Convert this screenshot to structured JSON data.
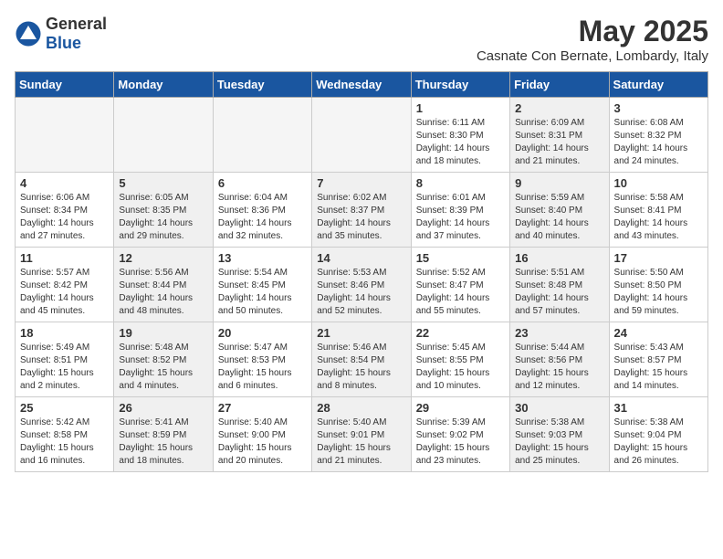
{
  "header": {
    "logo_general": "General",
    "logo_blue": "Blue",
    "month": "May 2025",
    "location": "Casnate Con Bernate, Lombardy, Italy"
  },
  "days_of_week": [
    "Sunday",
    "Monday",
    "Tuesday",
    "Wednesday",
    "Thursday",
    "Friday",
    "Saturday"
  ],
  "weeks": [
    [
      {
        "day": "",
        "info": "",
        "shaded": false,
        "empty": true
      },
      {
        "day": "",
        "info": "",
        "shaded": false,
        "empty": true
      },
      {
        "day": "",
        "info": "",
        "shaded": false,
        "empty": true
      },
      {
        "day": "",
        "info": "",
        "shaded": false,
        "empty": true
      },
      {
        "day": "1",
        "info": "Sunrise: 6:11 AM\nSunset: 8:30 PM\nDaylight: 14 hours\nand 18 minutes.",
        "shaded": false,
        "empty": false
      },
      {
        "day": "2",
        "info": "Sunrise: 6:09 AM\nSunset: 8:31 PM\nDaylight: 14 hours\nand 21 minutes.",
        "shaded": true,
        "empty": false
      },
      {
        "day": "3",
        "info": "Sunrise: 6:08 AM\nSunset: 8:32 PM\nDaylight: 14 hours\nand 24 minutes.",
        "shaded": false,
        "empty": false
      }
    ],
    [
      {
        "day": "4",
        "info": "Sunrise: 6:06 AM\nSunset: 8:34 PM\nDaylight: 14 hours\nand 27 minutes.",
        "shaded": false,
        "empty": false
      },
      {
        "day": "5",
        "info": "Sunrise: 6:05 AM\nSunset: 8:35 PM\nDaylight: 14 hours\nand 29 minutes.",
        "shaded": true,
        "empty": false
      },
      {
        "day": "6",
        "info": "Sunrise: 6:04 AM\nSunset: 8:36 PM\nDaylight: 14 hours\nand 32 minutes.",
        "shaded": false,
        "empty": false
      },
      {
        "day": "7",
        "info": "Sunrise: 6:02 AM\nSunset: 8:37 PM\nDaylight: 14 hours\nand 35 minutes.",
        "shaded": true,
        "empty": false
      },
      {
        "day": "8",
        "info": "Sunrise: 6:01 AM\nSunset: 8:39 PM\nDaylight: 14 hours\nand 37 minutes.",
        "shaded": false,
        "empty": false
      },
      {
        "day": "9",
        "info": "Sunrise: 5:59 AM\nSunset: 8:40 PM\nDaylight: 14 hours\nand 40 minutes.",
        "shaded": true,
        "empty": false
      },
      {
        "day": "10",
        "info": "Sunrise: 5:58 AM\nSunset: 8:41 PM\nDaylight: 14 hours\nand 43 minutes.",
        "shaded": false,
        "empty": false
      }
    ],
    [
      {
        "day": "11",
        "info": "Sunrise: 5:57 AM\nSunset: 8:42 PM\nDaylight: 14 hours\nand 45 minutes.",
        "shaded": false,
        "empty": false
      },
      {
        "day": "12",
        "info": "Sunrise: 5:56 AM\nSunset: 8:44 PM\nDaylight: 14 hours\nand 48 minutes.",
        "shaded": true,
        "empty": false
      },
      {
        "day": "13",
        "info": "Sunrise: 5:54 AM\nSunset: 8:45 PM\nDaylight: 14 hours\nand 50 minutes.",
        "shaded": false,
        "empty": false
      },
      {
        "day": "14",
        "info": "Sunrise: 5:53 AM\nSunset: 8:46 PM\nDaylight: 14 hours\nand 52 minutes.",
        "shaded": true,
        "empty": false
      },
      {
        "day": "15",
        "info": "Sunrise: 5:52 AM\nSunset: 8:47 PM\nDaylight: 14 hours\nand 55 minutes.",
        "shaded": false,
        "empty": false
      },
      {
        "day": "16",
        "info": "Sunrise: 5:51 AM\nSunset: 8:48 PM\nDaylight: 14 hours\nand 57 minutes.",
        "shaded": true,
        "empty": false
      },
      {
        "day": "17",
        "info": "Sunrise: 5:50 AM\nSunset: 8:50 PM\nDaylight: 14 hours\nand 59 minutes.",
        "shaded": false,
        "empty": false
      }
    ],
    [
      {
        "day": "18",
        "info": "Sunrise: 5:49 AM\nSunset: 8:51 PM\nDaylight: 15 hours\nand 2 minutes.",
        "shaded": false,
        "empty": false
      },
      {
        "day": "19",
        "info": "Sunrise: 5:48 AM\nSunset: 8:52 PM\nDaylight: 15 hours\nand 4 minutes.",
        "shaded": true,
        "empty": false
      },
      {
        "day": "20",
        "info": "Sunrise: 5:47 AM\nSunset: 8:53 PM\nDaylight: 15 hours\nand 6 minutes.",
        "shaded": false,
        "empty": false
      },
      {
        "day": "21",
        "info": "Sunrise: 5:46 AM\nSunset: 8:54 PM\nDaylight: 15 hours\nand 8 minutes.",
        "shaded": true,
        "empty": false
      },
      {
        "day": "22",
        "info": "Sunrise: 5:45 AM\nSunset: 8:55 PM\nDaylight: 15 hours\nand 10 minutes.",
        "shaded": false,
        "empty": false
      },
      {
        "day": "23",
        "info": "Sunrise: 5:44 AM\nSunset: 8:56 PM\nDaylight: 15 hours\nand 12 minutes.",
        "shaded": true,
        "empty": false
      },
      {
        "day": "24",
        "info": "Sunrise: 5:43 AM\nSunset: 8:57 PM\nDaylight: 15 hours\nand 14 minutes.",
        "shaded": false,
        "empty": false
      }
    ],
    [
      {
        "day": "25",
        "info": "Sunrise: 5:42 AM\nSunset: 8:58 PM\nDaylight: 15 hours\nand 16 minutes.",
        "shaded": false,
        "empty": false
      },
      {
        "day": "26",
        "info": "Sunrise: 5:41 AM\nSunset: 8:59 PM\nDaylight: 15 hours\nand 18 minutes.",
        "shaded": true,
        "empty": false
      },
      {
        "day": "27",
        "info": "Sunrise: 5:40 AM\nSunset: 9:00 PM\nDaylight: 15 hours\nand 20 minutes.",
        "shaded": false,
        "empty": false
      },
      {
        "day": "28",
        "info": "Sunrise: 5:40 AM\nSunset: 9:01 PM\nDaylight: 15 hours\nand 21 minutes.",
        "shaded": true,
        "empty": false
      },
      {
        "day": "29",
        "info": "Sunrise: 5:39 AM\nSunset: 9:02 PM\nDaylight: 15 hours\nand 23 minutes.",
        "shaded": false,
        "empty": false
      },
      {
        "day": "30",
        "info": "Sunrise: 5:38 AM\nSunset: 9:03 PM\nDaylight: 15 hours\nand 25 minutes.",
        "shaded": true,
        "empty": false
      },
      {
        "day": "31",
        "info": "Sunrise: 5:38 AM\nSunset: 9:04 PM\nDaylight: 15 hours\nand 26 minutes.",
        "shaded": false,
        "empty": false
      }
    ]
  ]
}
